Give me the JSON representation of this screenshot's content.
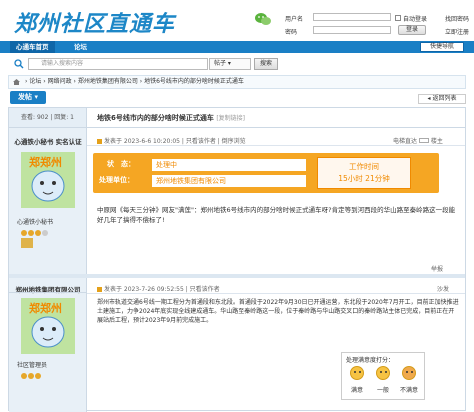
{
  "header": {
    "logo_text": "郑州社区直通车",
    "username_label": "用户名",
    "password_label": "密码",
    "auto_login": "自动登录",
    "find_password": "找回密码",
    "register": "立即注册",
    "login_button": "登录"
  },
  "nav": {
    "tabs": [
      {
        "label": "心通车首页"
      },
      {
        "label": "论坛"
      }
    ],
    "quick_nav": "快捷导航"
  },
  "search": {
    "placeholder": "请输入搜索内容",
    "type": "帖子",
    "button": "搜索"
  },
  "breadcrumb": {
    "items": [
      "论坛",
      "网络问政",
      "郑州地铁集团有限公司",
      "地铁6号线市内的部分啥时候正式通车"
    ]
  },
  "toolbar": {
    "post_button": "发帖",
    "back_button": "返回列表"
  },
  "thread": {
    "stats": "查看: 902 | 回复: 1",
    "title": "地铁6号线市内的部分啥时候正式通车",
    "copy_link": "[复制链接]"
  },
  "posts": [
    {
      "author": "心通铁小秘书 实名认证",
      "role": "心通铁小秘书",
      "meta": "发表于 2023-6-6 10:20:05 | 只看该作者 | 倒序浏览",
      "floor_actions": [
        "电梯直达",
        "楼主"
      ],
      "status": {
        "state_label": "状　态：",
        "state_value": "处理中",
        "unit_label": "处理单位：",
        "unit_value": "郑州地铁集团有限公司",
        "worktime_label": "工作时间",
        "worktime_value": "15小时 21分钟"
      },
      "body": "中原网《每天三分钟》网友\"满莲\"：郑州地铁6号线市内的部分啥时候正式通车呀?肯定等到河西段的华山路至秦岭路这一段能好几年了搞得不偿标了!",
      "report": "举报"
    },
    {
      "author": "郑州地铁集团有限公司",
      "role": "社区管理员",
      "meta": "发表于 2023-7-26 09:52:55 | 只看该作者",
      "floor": "沙发",
      "body": "郑州市轨道交通6号线一期工程分为首通段和东北段。首通段于2022年9月30日已开通运营，东北段于2020年7月开工，目前正加快推进土建施工，力争2024年底实现全线建成通车。华山路至秦岭路这一段，位于秦岭路与华山路交叉口的秦岭路站主体已完成，目前正在开展站后工程，预计2023年9月前完成施工。",
      "mood_title": "处理满意度打分：",
      "mood_options": [
        "满意",
        "一般",
        "不满意"
      ]
    }
  ],
  "colors": {
    "brand": "#1a7fc5",
    "accent": "#f5a623"
  }
}
